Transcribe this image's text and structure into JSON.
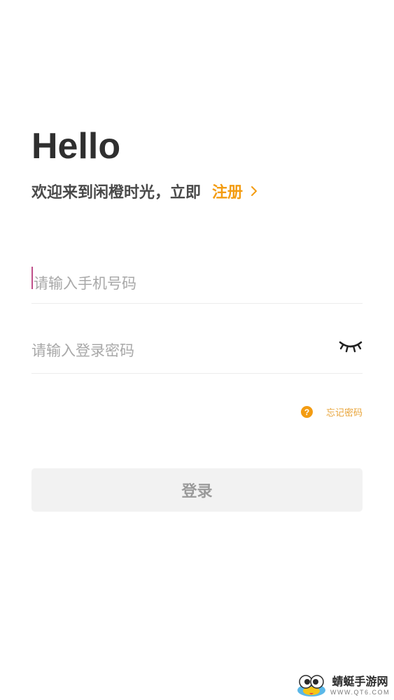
{
  "header": {
    "greeting": "Hello",
    "welcome_text": "欢迎来到闲橙时光，立即",
    "register_label": "注册"
  },
  "form": {
    "phone_placeholder": "请输入手机号码",
    "password_placeholder": "请输入登录密码",
    "forgot_icon_glyph": "?",
    "forgot_label": "忘记密码",
    "login_label": "登录"
  },
  "watermark": {
    "name": "蜻蜓手游网",
    "url": "WWW.QT6.COM"
  },
  "colors": {
    "accent": "#f39c12",
    "text_dark": "#2f2f2f",
    "placeholder": "#a8a8a8",
    "button_bg": "#f2f2f2"
  },
  "icons": {
    "register_arrow": "chevron-right-icon",
    "password_toggle": "eye-closed-icon",
    "forgot_help": "question-circle-icon",
    "watermark_logo": "dragonfly-logo-icon"
  }
}
